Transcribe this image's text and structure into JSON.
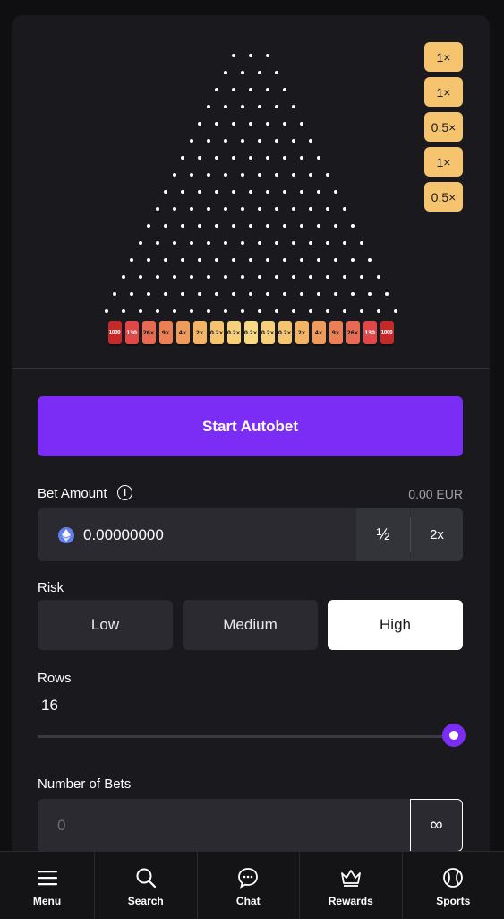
{
  "board": {
    "rows": 16,
    "buckets": [
      {
        "label": "1000",
        "color": "#c42a2a"
      },
      {
        "label": "130",
        "color": "#e04848"
      },
      {
        "label": "26×",
        "color": "#e86a52"
      },
      {
        "label": "9×",
        "color": "#ec8055"
      },
      {
        "label": "4×",
        "color": "#f09a5c"
      },
      {
        "label": "2×",
        "color": "#f3b465"
      },
      {
        "label": "0.2×",
        "color": "#f6c46f"
      },
      {
        "label": "0.2×",
        "color": "#f8d07a"
      },
      {
        "label": "0.2×",
        "color": "#f9d984"
      },
      {
        "label": "0.2×",
        "color": "#f8d07a"
      },
      {
        "label": "0.2×",
        "color": "#f6c46f"
      },
      {
        "label": "2×",
        "color": "#f3b465"
      },
      {
        "label": "4×",
        "color": "#f09a5c"
      },
      {
        "label": "9×",
        "color": "#ec8055"
      },
      {
        "label": "26×",
        "color": "#e86a52"
      },
      {
        "label": "130",
        "color": "#e04848"
      },
      {
        "label": "1000",
        "color": "#c42a2a"
      }
    ],
    "history": [
      "1×",
      "1×",
      "0.5×",
      "1×",
      "0.5×"
    ]
  },
  "controls": {
    "start_label": "Start Autobet",
    "bet_amount_label": "Bet Amount",
    "currency_value": "0.00 EUR",
    "bet_value": "0.00000000",
    "half_label": "½",
    "double_label": "2x",
    "risk_label": "Risk",
    "risk_options": [
      "Low",
      "Medium",
      "High"
    ],
    "risk_selected": "High",
    "rows_label": "Rows",
    "rows_value": "16",
    "rows_slider_fraction": 1.0,
    "number_of_bets_label": "Number of Bets",
    "number_of_bets_placeholder": "0",
    "infinity_label": "∞"
  },
  "nav": [
    {
      "label": "Menu",
      "icon": "menu-icon"
    },
    {
      "label": "Search",
      "icon": "search-icon"
    },
    {
      "label": "Chat",
      "icon": "chat-icon"
    },
    {
      "label": "Rewards",
      "icon": "crown-icon"
    },
    {
      "label": "Sports",
      "icon": "tennis-ball-icon"
    }
  ],
  "colors": {
    "accent": "#7b2cf5",
    "background": "#0f0f11",
    "card": "#1a1a1e",
    "input": "#2a2a30"
  }
}
